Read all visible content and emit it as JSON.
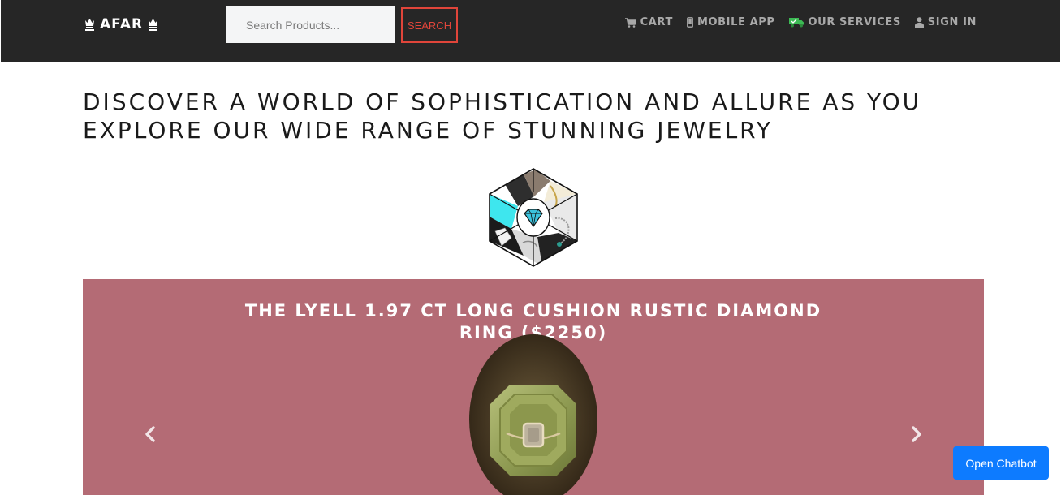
{
  "header": {
    "brand": "AFAR",
    "brand_icon": "crown-icon",
    "search": {
      "placeholder": "Search Products...",
      "value": ""
    },
    "search_button": "SEARCH",
    "nav": [
      {
        "label": "CART",
        "icon": "cart-icon"
      },
      {
        "label": "MOBILE APP",
        "icon": "mobile-icon"
      },
      {
        "label": "OUR SERVICES",
        "icon": "truck-icon"
      },
      {
        "label": "SIGN IN",
        "icon": "user-icon"
      }
    ]
  },
  "main": {
    "headline": "DISCOVER A WORLD OF SOPHISTICATION AND ALLURE AS YOU EXPLORE OUR WIDE RANGE OF STUNNING JEWELRY",
    "logo": "jewelry-cube-logo",
    "carousel": {
      "slide_title": "THE LYELL 1.97 CT LONG CUSHION RUSTIC DIAMOND RING ($2250)",
      "prev_icon": "chevron-left-icon",
      "next_icon": "chevron-right-icon"
    }
  },
  "chatbot_button": "Open Chatbot",
  "colors": {
    "navbar_bg": "#262626",
    "search_accent": "#e0453a",
    "carousel_bg": "#b46b75",
    "chatbot_bg": "#0d7bff",
    "services_icon": "#3cba54"
  }
}
